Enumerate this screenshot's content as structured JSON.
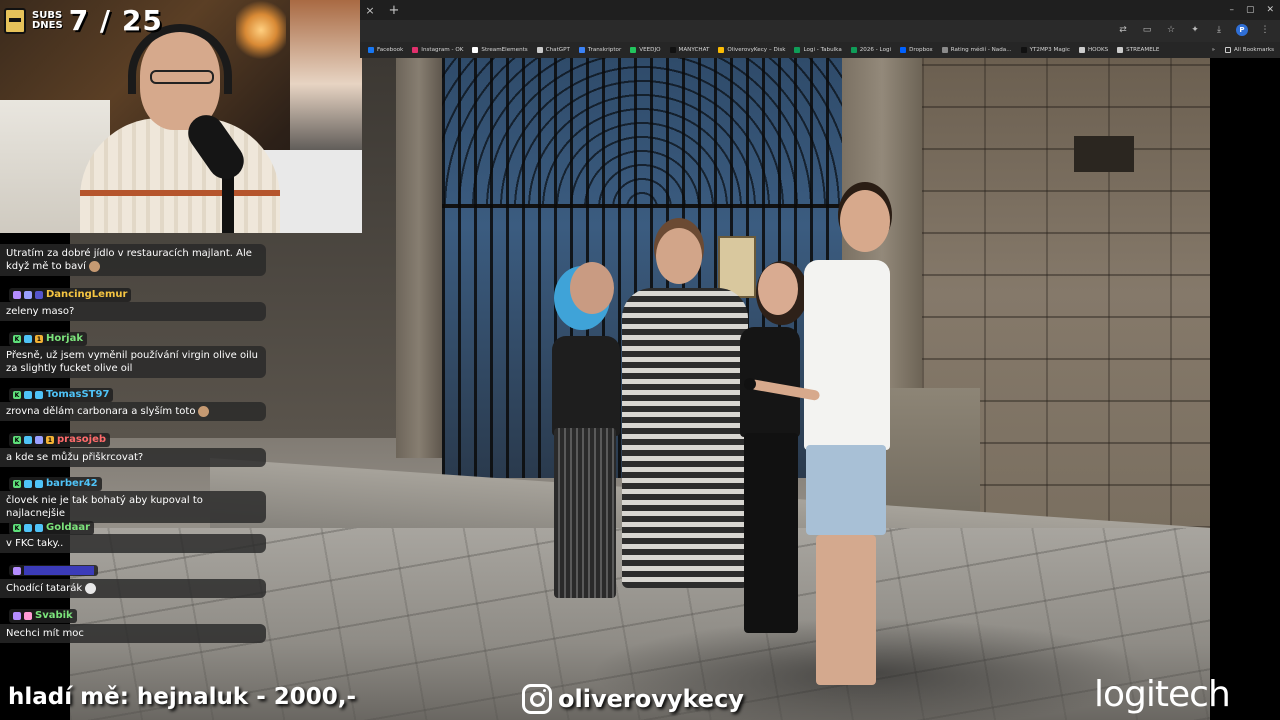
{
  "browser": {
    "tab_close": "×",
    "tab_new": "+",
    "window_controls": [
      "–",
      "▢",
      "✕"
    ],
    "toolbar_icons": [
      "translate-icon",
      "cast-icon",
      "star-icon",
      "extensions-icon",
      "downloads-icon"
    ],
    "profile_initial": "P",
    "bookmarks": [
      {
        "label": "Facebook",
        "color": "#1877f2"
      },
      {
        "label": "Instagram - OK",
        "color": "#e1306c"
      },
      {
        "label": "StreamElements",
        "color": "#ffffff"
      },
      {
        "label": "ChatGPT",
        "color": "#cccccc"
      },
      {
        "label": "Transkriptor",
        "color": "#3b82f6"
      },
      {
        "label": "VEEDJO",
        "color": "#22c55e"
      },
      {
        "label": "MANYCHAT",
        "color": "#111111"
      },
      {
        "label": "OliverovyKecy – Disk",
        "color": "#fbbc04"
      },
      {
        "label": "Logi - Tabulka",
        "color": "#0f9d58"
      },
      {
        "label": "2026 - Logi",
        "color": "#0f9d58"
      },
      {
        "label": "Dropbox",
        "color": "#0061ff"
      },
      {
        "label": "Rating médií - Nada...",
        "color": "#8a8a8a"
      },
      {
        "label": "YT2MP3 Magic",
        "color": "#111111"
      },
      {
        "label": "HOOKS",
        "color": "#cccccc"
      },
      {
        "label": "STREAMELE",
        "color": "#cccccc"
      }
    ],
    "bookmarks_overflow": "»",
    "all_bookmarks": "All Bookmarks"
  },
  "overlay": {
    "subs_word_1": "SUBS",
    "subs_word_2": "DNES",
    "subs_count": "7 / 25",
    "donation": "hladí mě: hejnaluk - 2000,-",
    "instagram_handle": "oliverovykecy",
    "sponsor": "logitech"
  },
  "chat": {
    "messages": [
      {
        "user": "",
        "text": "Utratím za dobré jídlo v restauracích majlant. Ale když mě to baví"
      },
      {
        "user": "DancingLemur",
        "color": "#f5c542",
        "text": "zeleny maso?"
      },
      {
        "user": "Horjak",
        "color": "#7be37b",
        "text": "Přesně, už jsem vyměnil používání virgin olive oilu za slightly fucket olive oil"
      },
      {
        "user": "TomasST97",
        "color": "#4fc3f7",
        "text": "zrovna dělám carbonara a slyším toto"
      },
      {
        "user": "prasojeb",
        "color": "#ff6b6b",
        "text": "a kde se můžu přiškrcovat?"
      },
      {
        "user": "barber42",
        "color": "#4fc3f7",
        "text": "človek nie je tak bohatý aby kupoval to najlacnejšie"
      },
      {
        "user": "Goldaar",
        "color": "#7be37b",
        "text": "v FKC taky.."
      },
      {
        "user": "",
        "color": "#5a5aff",
        "text": "Chodící tatarák"
      },
      {
        "user": "Svabik",
        "color": "#7be37b",
        "text": "Nechci mít moc"
      }
    ]
  }
}
